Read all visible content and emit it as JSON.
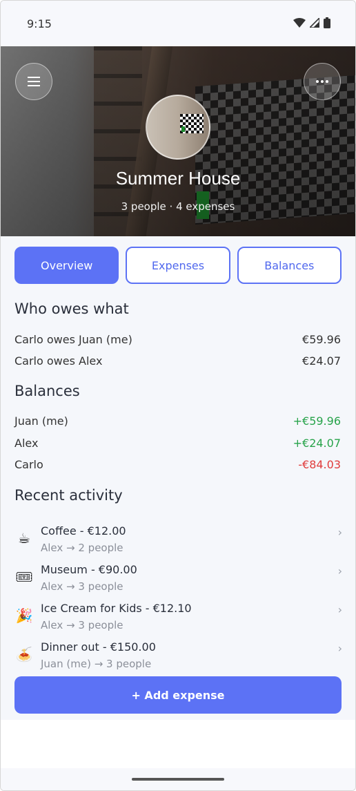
{
  "status_bar": {
    "time": "9:15"
  },
  "group": {
    "name": "Summer House",
    "subtitle": "3 people · 4 expenses"
  },
  "tabs": [
    {
      "label": "Overview",
      "active": true
    },
    {
      "label": "Expenses",
      "active": false
    },
    {
      "label": "Balances",
      "active": false
    }
  ],
  "owes": {
    "title": "Who owes what",
    "rows": [
      {
        "label": "Carlo owes Juan (me)",
        "amount": "€59.96"
      },
      {
        "label": "Carlo owes Alex",
        "amount": "€24.07"
      }
    ]
  },
  "balances": {
    "title": "Balances",
    "rows": [
      {
        "name": "Juan (me)",
        "amount": "+€59.96",
        "status": "positive"
      },
      {
        "name": "Alex",
        "amount": "+€24.07",
        "status": "positive"
      },
      {
        "name": "Carlo",
        "amount": "-€84.03",
        "status": "negative"
      }
    ]
  },
  "activity": {
    "title": "Recent activity",
    "items": [
      {
        "icon": "coffee-icon",
        "emoji": "☕",
        "title": "Coffee - €12.00",
        "sub": "Alex → 2 people"
      },
      {
        "icon": "ticket-icon",
        "emoji": "🎟",
        "title": "Museum - €90.00",
        "sub": "Alex → 3 people"
      },
      {
        "icon": "party-popper-icon",
        "emoji": "🎉",
        "title": "Ice Cream for Kids - €12.10",
        "sub": "Alex → 3 people"
      },
      {
        "icon": "spaghetti-icon",
        "emoji": "🍝",
        "title": "Dinner out - €150.00",
        "sub": "Juan (me) → 3 people"
      }
    ]
  },
  "add_button": {
    "label": "+ Add expense"
  },
  "colors": {
    "accent": "#5c72f5",
    "positive": "#27a34a",
    "negative": "#e03c3c"
  }
}
